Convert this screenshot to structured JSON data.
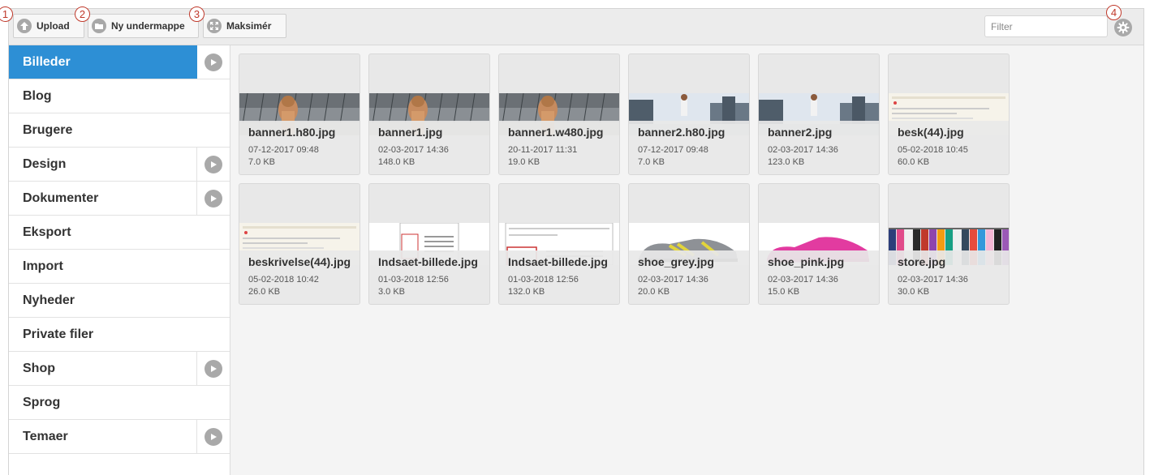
{
  "toolbar": {
    "upload_label": "Upload",
    "new_folder_label": "Ny undermappe",
    "maximize_label": "Maksimér",
    "filter_placeholder": "Filter",
    "markers": [
      "1",
      "2",
      "3",
      "4"
    ]
  },
  "sidebar": {
    "items": [
      {
        "label": "Billeder",
        "active": true,
        "has_children": true
      },
      {
        "label": "Blog",
        "active": false,
        "has_children": false
      },
      {
        "label": "Brugere",
        "active": false,
        "has_children": false
      },
      {
        "label": "Design",
        "active": false,
        "has_children": true
      },
      {
        "label": "Dokumenter",
        "active": false,
        "has_children": true
      },
      {
        "label": "Eksport",
        "active": false,
        "has_children": false
      },
      {
        "label": "Import",
        "active": false,
        "has_children": false
      },
      {
        "label": "Nyheder",
        "active": false,
        "has_children": false
      },
      {
        "label": "Private filer",
        "active": false,
        "has_children": false
      },
      {
        "label": "Shop",
        "active": false,
        "has_children": true
      },
      {
        "label": "Sprog",
        "active": false,
        "has_children": false
      },
      {
        "label": "Temaer",
        "active": false,
        "has_children": true
      }
    ]
  },
  "files": [
    {
      "name": "banner1.h80.jpg",
      "date": "07-12-2017 09:48",
      "size": "7.0 KB",
      "thumb": "woman-icon"
    },
    {
      "name": "banner1.jpg",
      "date": "02-03-2017 14:36",
      "size": "148.0 KB",
      "thumb": "woman-icon"
    },
    {
      "name": "banner1.w480.jpg",
      "date": "20-11-2017 11:31",
      "size": "19.0 KB",
      "thumb": "woman-icon"
    },
    {
      "name": "banner2.h80.jpg",
      "date": "07-12-2017 09:48",
      "size": "7.0 KB",
      "thumb": "city-icon"
    },
    {
      "name": "banner2.jpg",
      "date": "02-03-2017 14:36",
      "size": "123.0 KB",
      "thumb": "city-icon"
    },
    {
      "name": "besk(44).jpg",
      "date": "05-02-2018 10:45",
      "size": "60.0 KB",
      "thumb": "editor-icon"
    },
    {
      "name": "beskrivelse(44).jpg",
      "date": "05-02-2018 10:42",
      "size": "26.0 KB",
      "thumb": "editor-icon"
    },
    {
      "name": "Indsaet-billede.jpg",
      "date": "01-03-2018 12:56",
      "size": "3.0 KB",
      "thumb": "dialog-icon"
    },
    {
      "name": "Indsaet-billede.jpg",
      "date": "01-03-2018 12:56",
      "size": "132.0 KB",
      "thumb": "dialog-large-icon"
    },
    {
      "name": "shoe_grey.jpg",
      "date": "02-03-2017 14:36",
      "size": "20.0 KB",
      "thumb": "shoe-grey-icon"
    },
    {
      "name": "shoe_pink.jpg",
      "date": "02-03-2017 14:36",
      "size": "15.0 KB",
      "thumb": "shoe-pink-icon"
    },
    {
      "name": "store.jpg",
      "date": "02-03-2017 14:36",
      "size": "30.0 KB",
      "thumb": "clothes-rack-icon"
    }
  ],
  "colors": {
    "active": "#2d8fd5",
    "marker": "#c0392b"
  }
}
